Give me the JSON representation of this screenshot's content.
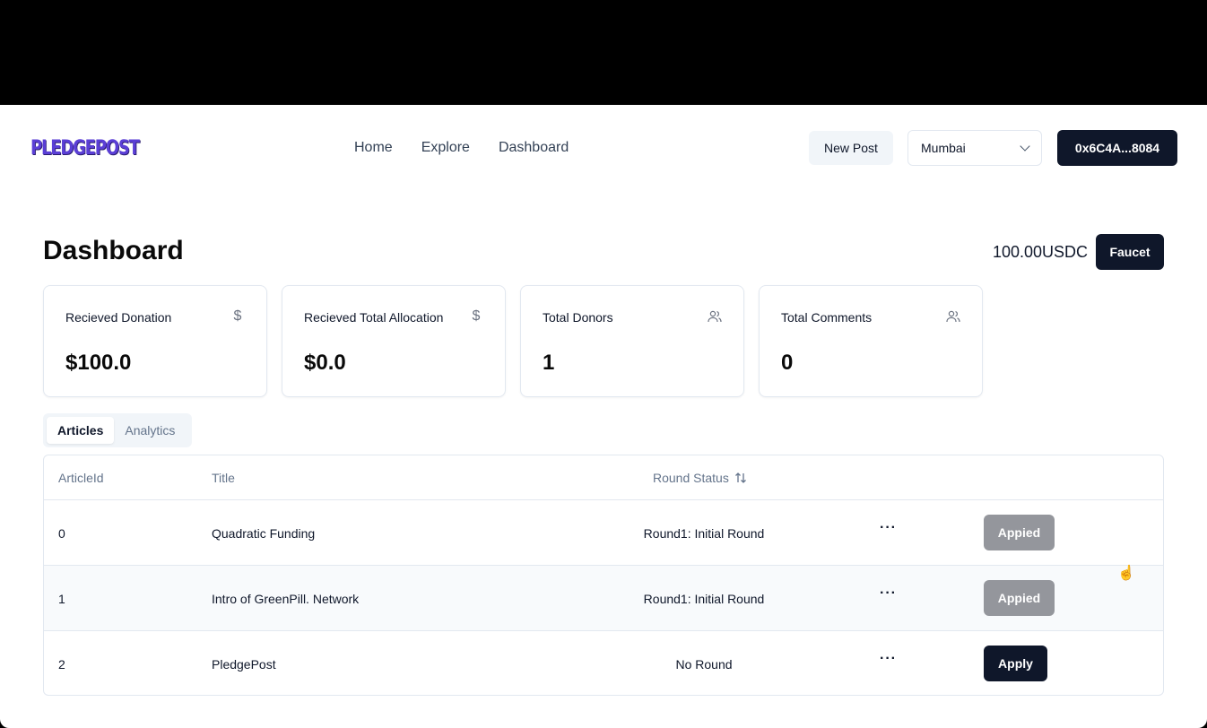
{
  "header": {
    "logo": "PLEDGEPOST",
    "nav": [
      "Home",
      "Explore",
      "Dashboard"
    ],
    "new_post_label": "New Post",
    "network_select": "Mumbai",
    "wallet_label": "0x6C4A...8084"
  },
  "dashboard": {
    "title": "Dashboard",
    "balance": "100.00USDC",
    "faucet_label": "Faucet"
  },
  "cards": [
    {
      "label": "Recieved Donation",
      "value": "$100.0",
      "icon": "dollar-icon"
    },
    {
      "label": "Recieved Total Allocation",
      "value": "$0.0",
      "icon": "dollar-icon"
    },
    {
      "label": "Total Donors",
      "value": "1",
      "icon": "users-icon"
    },
    {
      "label": "Total Comments",
      "value": "0",
      "icon": "users-icon"
    }
  ],
  "tabs": [
    "Articles",
    "Analytics"
  ],
  "table": {
    "headers": [
      "ArticleId",
      "Title",
      "Round Status"
    ],
    "rows": [
      {
        "id": "0",
        "title": "Quadratic Funding",
        "status": "Round1: Initial Round",
        "menu": "···",
        "action": "Appied"
      },
      {
        "id": "1",
        "title": "Intro of GreenPill. Network",
        "status": "Round1: Initial Round",
        "menu": "···",
        "action": "Appied"
      },
      {
        "id": "2",
        "title": "PledgePost",
        "status": "No Round",
        "menu": "···",
        "action": "Apply"
      }
    ]
  },
  "colors": {
    "brand": "#5b3fd6",
    "primary_button": "#0f172a",
    "disabled_button": "#94969c"
  }
}
